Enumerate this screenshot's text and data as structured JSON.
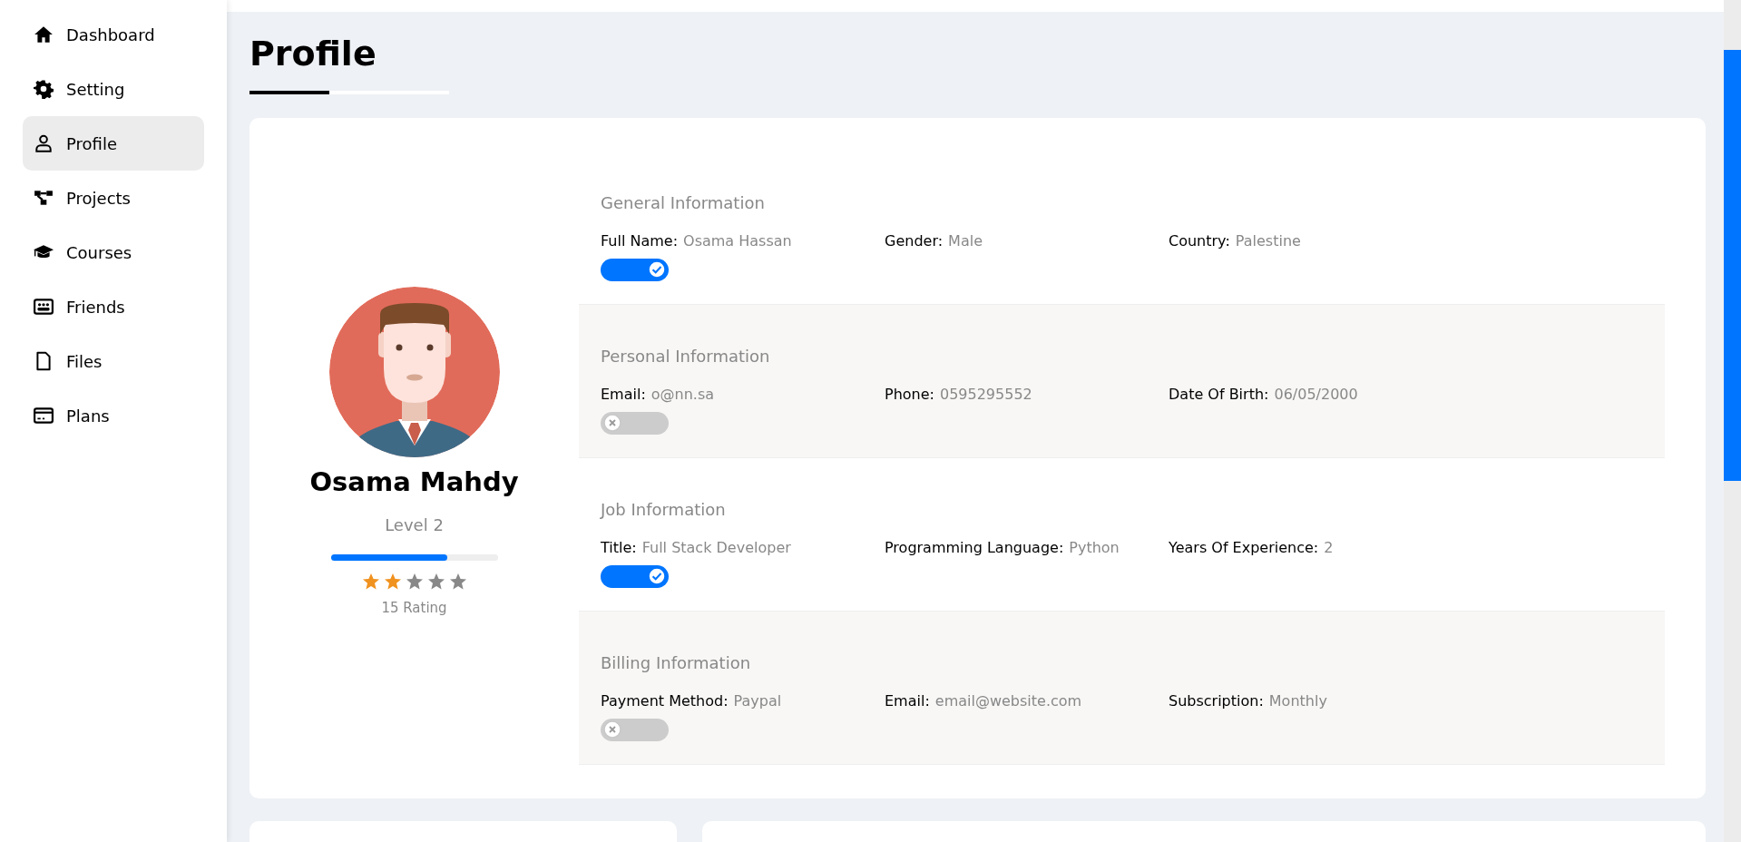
{
  "sidebar": {
    "items": [
      {
        "label": "Dashboard",
        "selected": false
      },
      {
        "label": "Setting",
        "selected": false
      },
      {
        "label": "Profile",
        "selected": true
      },
      {
        "label": "Projects",
        "selected": false
      },
      {
        "label": "Courses",
        "selected": false
      },
      {
        "label": "Friends",
        "selected": false
      },
      {
        "label": "Files",
        "selected": false
      },
      {
        "label": "Plans",
        "selected": false
      }
    ]
  },
  "page": {
    "title": "Profile"
  },
  "profile": {
    "name": "Osama Mahdy",
    "level_text": "Level 2",
    "level": 0.7,
    "stars": 2,
    "rating": "15 Rating"
  },
  "sections": [
    {
      "title": "General Information",
      "toggle_on": true,
      "fields": [
        {
          "label": "Full Name:",
          "value": "Osama Hassan"
        },
        {
          "label": "Gender:",
          "value": "Male"
        },
        {
          "label": "Country:",
          "value": "Palestine"
        }
      ]
    },
    {
      "title": "Personal Information",
      "toggle_on": false,
      "fields": [
        {
          "label": "Email:",
          "value": "o@nn.sa"
        },
        {
          "label": "Phone:",
          "value": "0595295552"
        },
        {
          "label": "Date Of Birth:",
          "value": "06/05/2000"
        }
      ]
    },
    {
      "title": "Job Information",
      "toggle_on": true,
      "fields": [
        {
          "label": "Title:",
          "value": "Full Stack Developer"
        },
        {
          "label": "Programming Language:",
          "value": "Python"
        },
        {
          "label": "Years Of Experience:",
          "value": "2"
        }
      ]
    },
    {
      "title": "Billing Information",
      "toggle_on": false,
      "fields": [
        {
          "label": "Payment Method:",
          "value": "Paypal"
        },
        {
          "label": "Email:",
          "value": "email@website.com"
        },
        {
          "label": "Subscription:",
          "value": "Monthly"
        }
      ]
    }
  ]
}
